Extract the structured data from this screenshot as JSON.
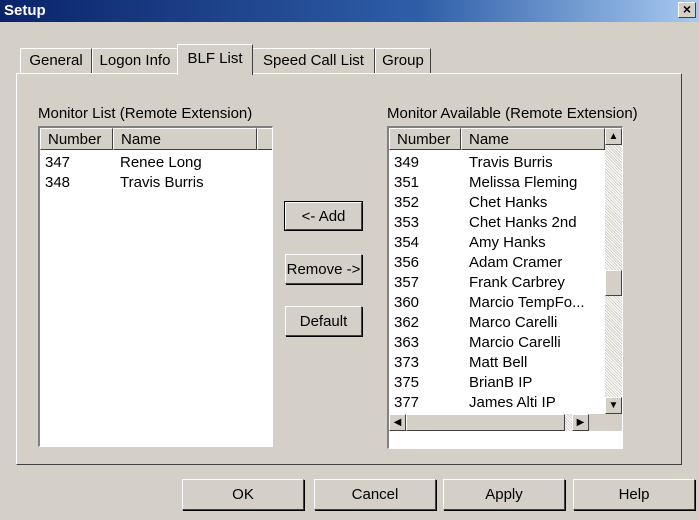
{
  "window": {
    "title": "Setup",
    "close_glyph": "×"
  },
  "tabs": [
    {
      "label": "General"
    },
    {
      "label": "Logon Info"
    },
    {
      "label": "BLF List"
    },
    {
      "label": "Speed Call List"
    },
    {
      "label": "Group"
    }
  ],
  "active_tab": "BLF List",
  "monitor_list": {
    "label": "Monitor List (Remote Extension)",
    "columns": [
      "Number",
      "Name"
    ],
    "rows": [
      {
        "number": "347",
        "name": "Renee Long"
      },
      {
        "number": "348",
        "name": "Travis Burris"
      }
    ]
  },
  "monitor_available": {
    "label": "Monitor Available (Remote Extension)",
    "columns": [
      "Number",
      "Name"
    ],
    "rows": [
      {
        "number": "349",
        "name": "Travis Burris"
      },
      {
        "number": "351",
        "name": "Melissa Fleming"
      },
      {
        "number": "352",
        "name": "Chet Hanks"
      },
      {
        "number": "353",
        "name": "Chet Hanks 2nd"
      },
      {
        "number": "354",
        "name": "Amy Hanks"
      },
      {
        "number": "356",
        "name": "Adam Cramer"
      },
      {
        "number": "357",
        "name": "Frank Carbrey"
      },
      {
        "number": "360",
        "name": "Marcio TempFo..."
      },
      {
        "number": "362",
        "name": "Marco Carelli"
      },
      {
        "number": "363",
        "name": "Marcio Carelli"
      },
      {
        "number": "373",
        "name": "Matt Bell"
      },
      {
        "number": "375",
        "name": "BrianB IP"
      },
      {
        "number": "377",
        "name": "James Alti IP"
      }
    ]
  },
  "middle_buttons": {
    "add": "<- Add",
    "remove": "Remove ->",
    "default": "Default"
  },
  "footer_buttons": {
    "ok": "OK",
    "cancel": "Cancel",
    "apply": "Apply",
    "help": "Help"
  },
  "icons": {
    "scroll_up": "▲",
    "scroll_down": "▼",
    "scroll_left": "◀",
    "scroll_right": "▶"
  },
  "colors": {
    "face": "#d4d0c8",
    "title_start": "#0a246a",
    "title_end": "#a6caf0"
  }
}
